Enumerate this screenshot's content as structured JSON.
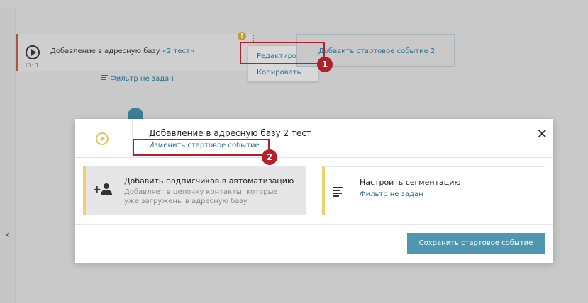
{
  "background": {
    "collapse_arrow": "‹",
    "start_card": {
      "title": "Добавление в адресную базу",
      "title_link": "«2 тест»",
      "id_label": "ID: 1"
    },
    "warning_mark": "!",
    "kebab": "⋮",
    "menu": {
      "edit": "Редактировать",
      "copy": "Копировать"
    },
    "add_event_label": "Добавить стартовое событие 2",
    "filter_label": "Фильтр не задан",
    "plus": "+"
  },
  "annotations": {
    "badge1": "1",
    "badge2": "2",
    "color": "#b3202b"
  },
  "modal": {
    "title": "Добавление в адресную базу 2 тест",
    "change_link": "Изменить стартовое событие",
    "close_icon": "×",
    "option1": {
      "title": "Добавить подписчиков в автоматизацию",
      "description": "Добавляет в цепочку контакты, которые уже загружены в адресную базу",
      "icon": "add-person-icon"
    },
    "option2": {
      "title": "Настроить сегментацию",
      "link": "Фильтр не задан",
      "icon": "filter-lines-icon"
    },
    "save_button": "Сохранить стартовое событие"
  },
  "colors": {
    "accent": "#4f96b0",
    "link": "#2a6f8e",
    "highlight_bar": "#f1d06c"
  }
}
